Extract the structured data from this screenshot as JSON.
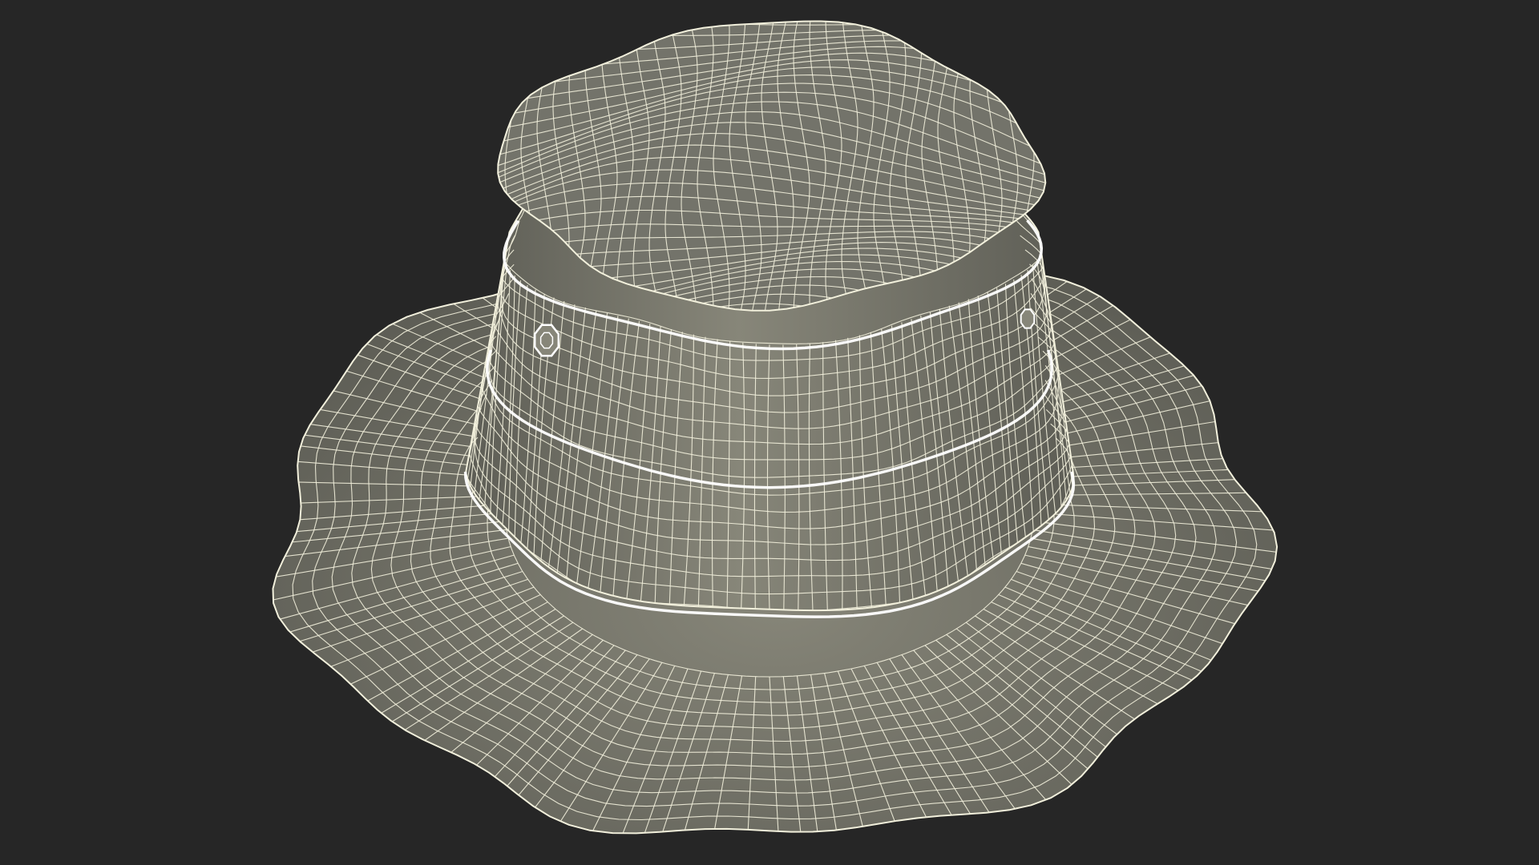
{
  "scene": {
    "subject_icon": "bucket-hat-wireframe-icon",
    "colors": {
      "background": "#262626",
      "surface": "#73736a",
      "surface_light": "#878679",
      "surface_dark": "#5d5d55",
      "wire": "#f2f0dc",
      "seam": "#ffffff"
    }
  }
}
